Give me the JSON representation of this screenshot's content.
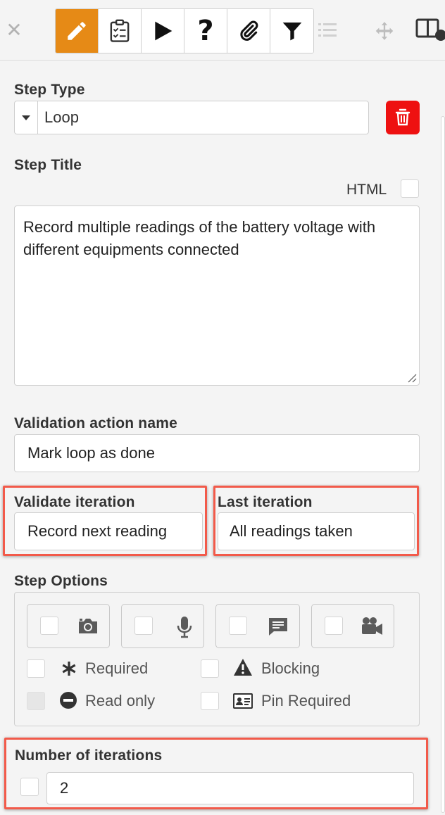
{
  "toolbar": {
    "close_icon": "close-icon",
    "buttons": [
      {
        "name": "edit",
        "icon": "pencil-icon",
        "active": true
      },
      {
        "name": "checklist",
        "icon": "clipboard-checklist-icon",
        "active": false
      },
      {
        "name": "play",
        "icon": "play-icon",
        "active": false
      },
      {
        "name": "help",
        "icon": "question-icon",
        "active": false
      },
      {
        "name": "attach",
        "icon": "paperclip-icon",
        "active": false
      },
      {
        "name": "filter",
        "icon": "filter-icon",
        "active": false
      }
    ],
    "list_icon": "list-icon",
    "move_icon": "move-icon",
    "layout_icon": "layout-icon"
  },
  "form": {
    "step_type_label": "Step Type",
    "step_type_value": "Loop",
    "step_title_label": "Step Title",
    "html_label": "HTML",
    "step_title_value": "Record multiple readings of the battery voltage with different equipments connected",
    "validation_action_label": "Validation action name",
    "validation_action_value": "Mark loop as done",
    "validate_iteration_label": "Validate iteration",
    "validate_iteration_value": "Record next reading",
    "last_iteration_label": "Last iteration",
    "last_iteration_value": "All readings taken",
    "step_options_label": "Step Options",
    "media_options": [
      "camera-icon",
      "microphone-icon",
      "comment-icon",
      "video-camera-icon"
    ],
    "options": {
      "required": "Required",
      "blocking": "Blocking",
      "read_only": "Read only",
      "pin_required": "Pin Required"
    },
    "iterations_label": "Number of iterations",
    "iterations_value": "2"
  },
  "colors": {
    "accent": "#e68a16",
    "danger": "#ee1111",
    "highlight": "#f25a4a"
  }
}
